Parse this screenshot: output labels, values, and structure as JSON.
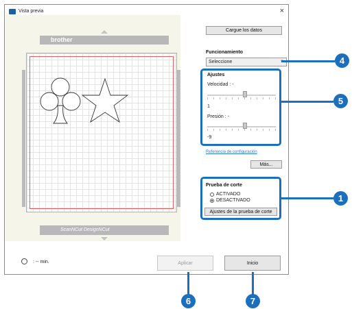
{
  "window": {
    "title": "Vista previa",
    "close_glyph": "×"
  },
  "mat": {
    "brand": "brother",
    "bottom_text": "ScanNCut   DesignNCut"
  },
  "panel": {
    "load_button": "Cargue los datos",
    "operation_label": "Funcionamiento",
    "operation_value": "Seleccione",
    "settings_title": "Ajustes",
    "speed_label": "Velocidad : -",
    "speed_value": "1",
    "pressure_label": "Presión : -",
    "pressure_value": "-9",
    "settings_link": "Referencia de configuración",
    "more_button": "Más...",
    "trial_title": "Prueba de corte",
    "trial_on": "ACTIVADO",
    "trial_off": "DESACTIVADO",
    "trial_settings_button": "Ajustes de la prueba de corte"
  },
  "footer": {
    "time_label": ":  -- min.",
    "apply_button": "Aplicar",
    "start_button": "Inicio"
  },
  "callouts": {
    "c1": "1",
    "c4": "4",
    "c5": "5",
    "c6": "6",
    "c7": "7"
  },
  "colors": {
    "callout": "#1c6fbd",
    "cut_area_border": "#e05d5d"
  },
  "icons": {
    "app": "preview-app-icon",
    "clock": "clock-icon"
  }
}
